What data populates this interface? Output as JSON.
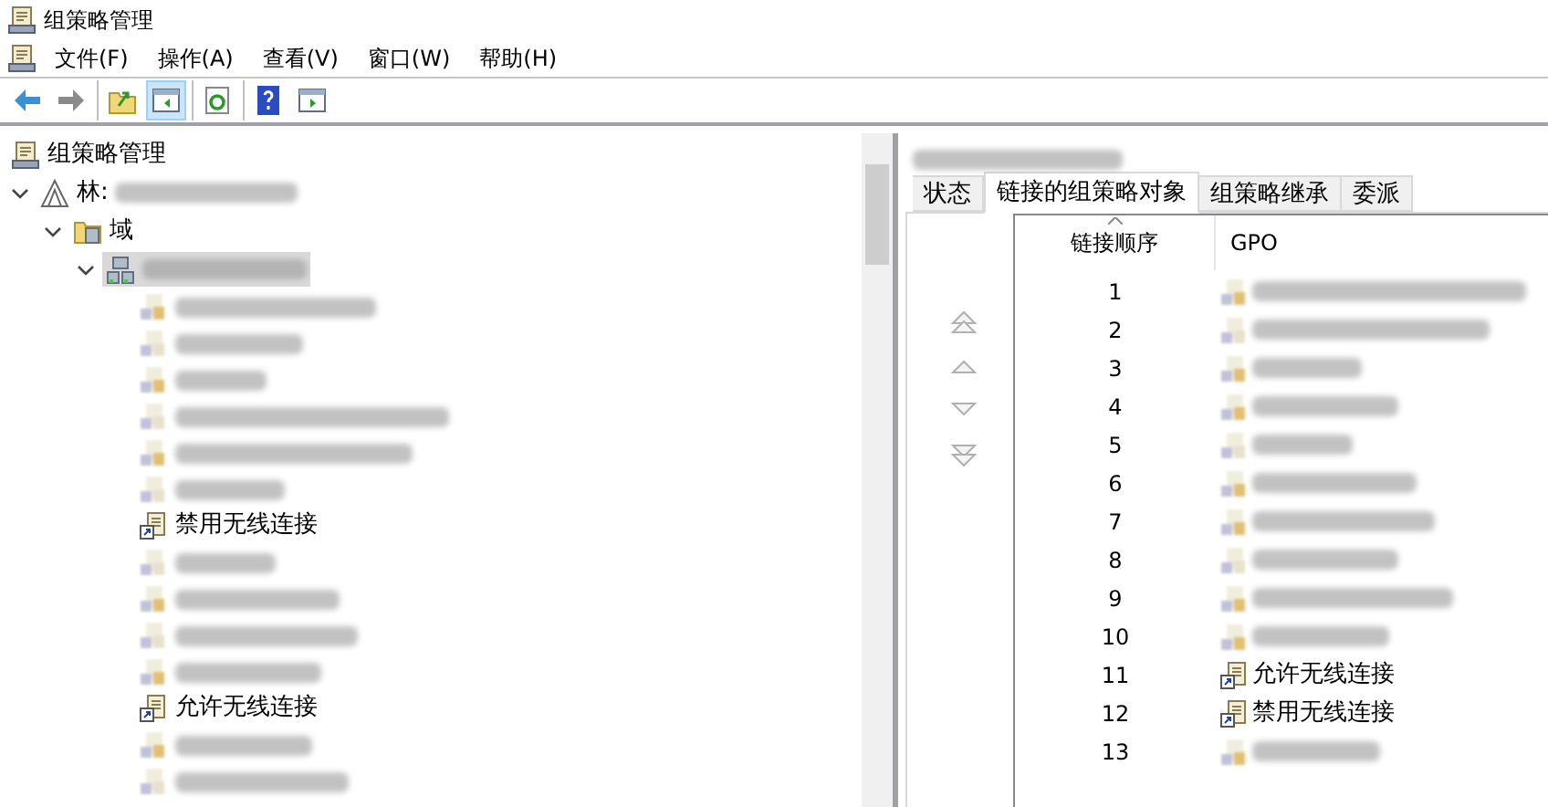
{
  "window": {
    "title": "组策略管理"
  },
  "menu": [
    "文件(F)",
    "操作(A)",
    "查看(V)",
    "窗口(W)",
    "帮助(H)"
  ],
  "toolbar": [
    {
      "kind": "back",
      "selected": false
    },
    {
      "kind": "forward",
      "selected": false
    },
    {
      "kind": "up",
      "selected": false
    },
    {
      "kind": "pane",
      "selected": true
    },
    {
      "kind": "refresh",
      "selected": false
    },
    {
      "kind": "help",
      "selected": false
    },
    {
      "kind": "view",
      "selected": false
    }
  ],
  "tree": {
    "label": "组策略管理",
    "kind": "root",
    "children": [
      {
        "label": "林:",
        "kind": "forest",
        "redacted": true,
        "expanded": true,
        "children": [
          {
            "label": "域",
            "kind": "domains",
            "expanded": true,
            "children": [
              {
                "kind": "domain",
                "redacted": true,
                "selected": true,
                "expanded": true,
                "children": [
                  {
                    "kind": "redacted"
                  },
                  {
                    "kind": "redacted"
                  },
                  {
                    "kind": "redacted"
                  },
                  {
                    "kind": "redacted"
                  },
                  {
                    "kind": "redacted"
                  },
                  {
                    "kind": "redacted"
                  },
                  {
                    "kind": "link",
                    "label": "禁用无线连接"
                  },
                  {
                    "kind": "redacted"
                  },
                  {
                    "kind": "redacted"
                  },
                  {
                    "kind": "redacted"
                  },
                  {
                    "kind": "redacted"
                  },
                  {
                    "kind": "link",
                    "label": "允许无线连接"
                  },
                  {
                    "kind": "redacted"
                  },
                  {
                    "kind": "redacted"
                  }
                ]
              }
            ]
          }
        ]
      }
    ]
  },
  "details": {
    "title_redacted": true,
    "tabs": [
      {
        "label": "状态",
        "selected": false
      },
      {
        "label": "链接的组策略对象",
        "selected": true
      },
      {
        "label": "组策略继承",
        "selected": false
      },
      {
        "label": "委派",
        "selected": false
      }
    ],
    "columns": [
      {
        "label": "链接顺序",
        "sorted": true
      },
      {
        "label": "GPO",
        "sorted": false
      }
    ],
    "rows": [
      {
        "order": "1",
        "kind": "redacted"
      },
      {
        "order": "2",
        "kind": "redacted"
      },
      {
        "order": "3",
        "kind": "redacted"
      },
      {
        "order": "4",
        "kind": "redacted"
      },
      {
        "order": "5",
        "kind": "redacted"
      },
      {
        "order": "6",
        "kind": "redacted"
      },
      {
        "order": "7",
        "kind": "redacted"
      },
      {
        "order": "8",
        "kind": "redacted"
      },
      {
        "order": "9",
        "kind": "redacted"
      },
      {
        "order": "10",
        "kind": "redacted"
      },
      {
        "order": "11",
        "kind": "link",
        "gpo": "允许无线连接"
      },
      {
        "order": "12",
        "kind": "link",
        "gpo": "禁用无线连接"
      },
      {
        "order": "13",
        "kind": "redacted"
      }
    ]
  }
}
